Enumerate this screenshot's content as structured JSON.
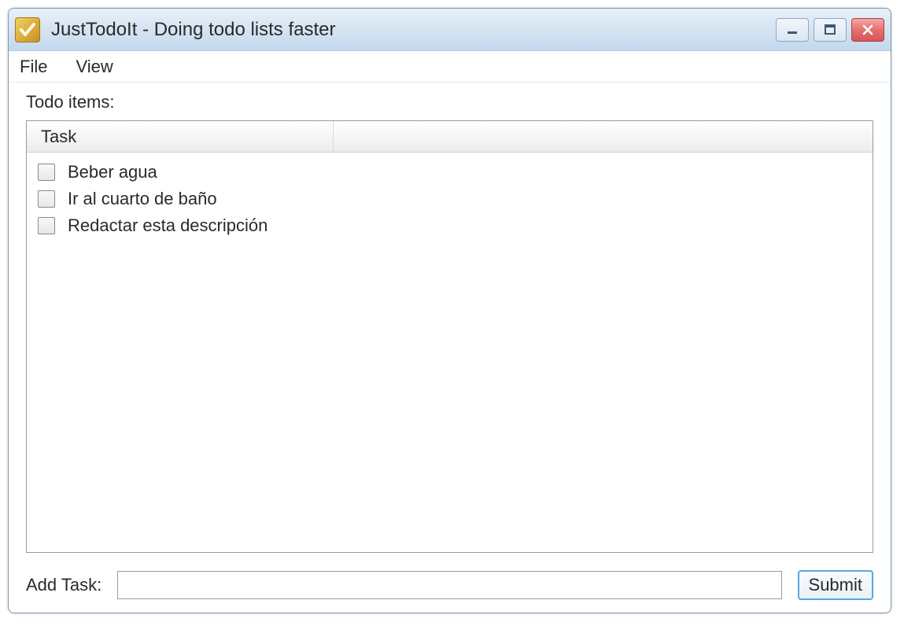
{
  "window": {
    "title": "JustTodoIt - Doing todo lists faster"
  },
  "menubar": {
    "file": "File",
    "view": "View"
  },
  "content": {
    "section_label": "Todo items:",
    "column_header": "Task",
    "tasks": [
      {
        "label": "Beber agua",
        "checked": false
      },
      {
        "label": "Ir al cuarto de baño",
        "checked": false
      },
      {
        "label": "Redactar esta descripción",
        "checked": false
      }
    ],
    "add_task_label": "Add Task:",
    "add_task_value": "",
    "submit_label": "Submit"
  },
  "icons": {
    "app": "checkmark-icon",
    "minimize": "minimize-icon",
    "maximize": "maximize-icon",
    "close": "close-icon"
  }
}
